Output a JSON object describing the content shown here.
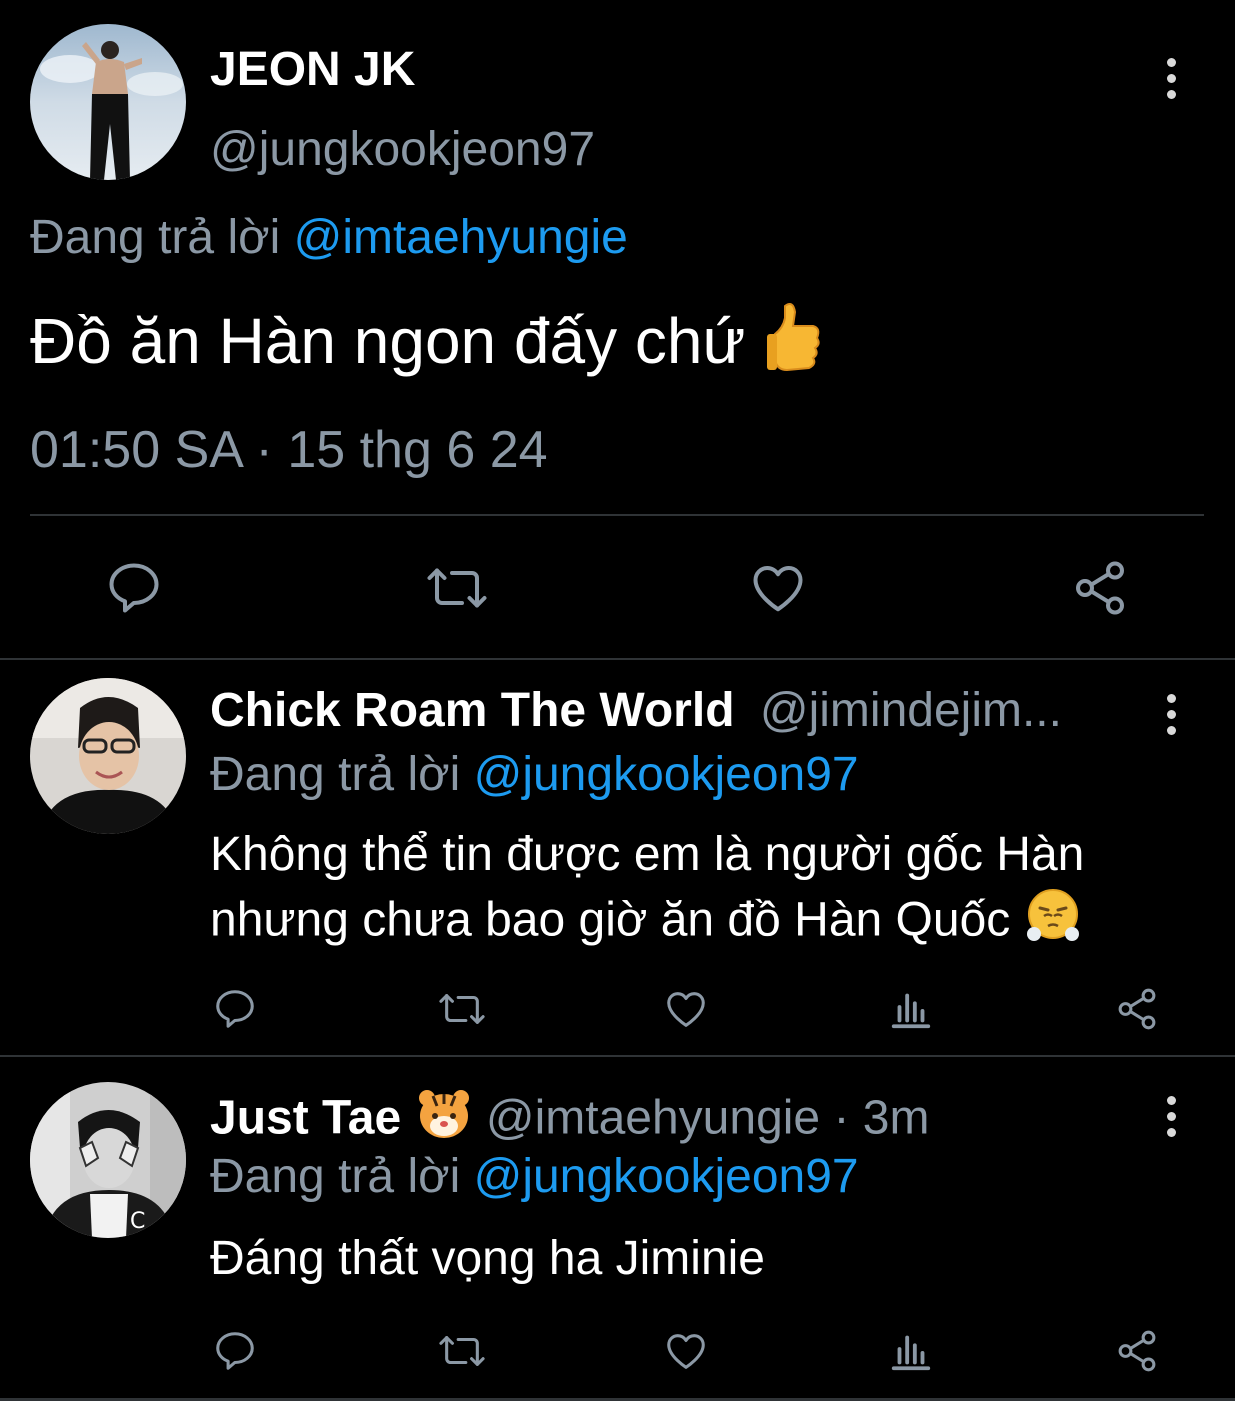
{
  "main_tweet": {
    "display_name": "JEON JK",
    "handle": "@jungkookjeon97",
    "reply_prefix": "Đang trả lời",
    "reply_to": "@imtaehyungie",
    "text": "Đồ ăn Hàn ngon đấy chứ",
    "emoji": "thumbs-up",
    "time": "01:50 SA",
    "separator": "·",
    "date": "15 thg 6 24"
  },
  "replies": [
    {
      "display_name": "Chick Roam The World",
      "handle": "@jimindejim...",
      "reply_prefix": "Đang trả lời",
      "reply_to": "@jungkookjeon97",
      "text_line1": "Không thể tin được em là người gốc Hàn",
      "text_line2": "nhưng chưa bao giờ ăn đồ Hàn Quốc",
      "emoji": "face-with-steam"
    },
    {
      "display_name": "Just Tae",
      "name_emoji": "tiger-face",
      "handle": "@imtaehyungie",
      "separator": "·",
      "time_ago": "3m",
      "reply_prefix": "Đang trả lời",
      "reply_to": "@jungkookjeon97",
      "text": "Đáng thất vọng ha Jiminie"
    }
  ],
  "colors": {
    "background": "#000000",
    "muted": "#8b98a5",
    "link": "#1d9bf0",
    "divider": "#2f3336",
    "icon": "#8b98a5"
  },
  "icons": [
    "reply-icon",
    "retweet-icon",
    "like-icon",
    "views-icon",
    "share-icon",
    "more-options-icon"
  ]
}
